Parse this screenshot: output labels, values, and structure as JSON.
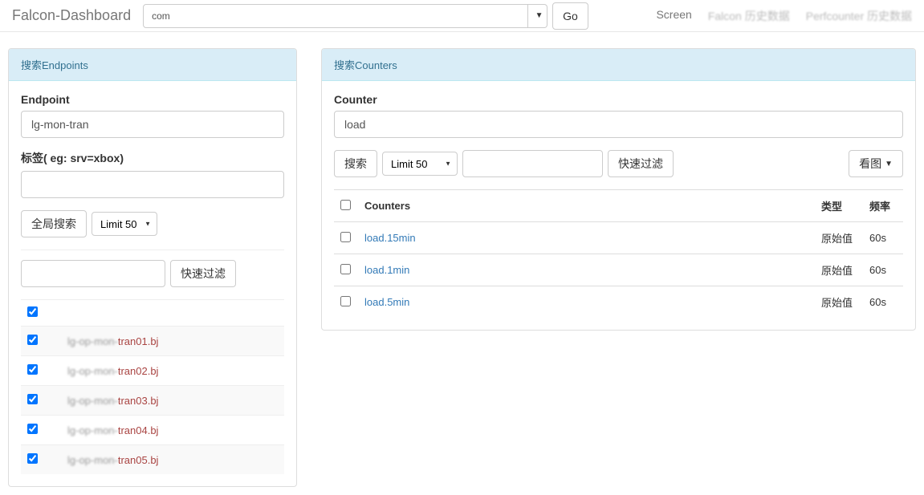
{
  "navbar": {
    "brand": "Falcon-Dashboard",
    "search_value": "com",
    "go_label": "Go",
    "links": [
      "Screen",
      "Falcon 历史数据",
      "Perfcounter 历史数据"
    ]
  },
  "left_panel": {
    "heading": "搜索Endpoints",
    "endpoint_label": "Endpoint",
    "endpoint_value": "lg-mon-tran",
    "tags_label": "标签( eg: srv=xbox)",
    "tags_value": "",
    "global_search_label": "全局搜索",
    "limit_label": "Limit 50",
    "quick_filter_label": "快速过滤",
    "filter_value": "",
    "select_all_checked": true,
    "hosts": [
      {
        "name_prefix": "lg-op-mon-",
        "name_suffix": "tran01.bj",
        "checked": true
      },
      {
        "name_prefix": "lg-op-mon-",
        "name_suffix": "tran02.bj",
        "checked": true
      },
      {
        "name_prefix": "lg-op-mon-",
        "name_suffix": "tran03.bj",
        "checked": true
      },
      {
        "name_prefix": "lg-op-mon-",
        "name_suffix": "tran04.bj",
        "checked": true
      },
      {
        "name_prefix": "lg-op-mon-",
        "name_suffix": "tran05.bj",
        "checked": true
      }
    ]
  },
  "right_panel": {
    "heading": "搜索Counters",
    "counter_label": "Counter",
    "counter_value": "load",
    "search_label": "搜索",
    "limit_label": "Limit 50",
    "quick_filter_label": "快速过滤",
    "view_label": "看图",
    "table": {
      "col_counter": "Counters",
      "col_type": "类型",
      "col_freq": "频率",
      "rows": [
        {
          "counter": "load.15min",
          "type": "原始值",
          "freq": "60s",
          "checked": false
        },
        {
          "counter": "load.1min",
          "type": "原始值",
          "freq": "60s",
          "checked": false
        },
        {
          "counter": "load.5min",
          "type": "原始值",
          "freq": "60s",
          "checked": false
        }
      ]
    }
  }
}
